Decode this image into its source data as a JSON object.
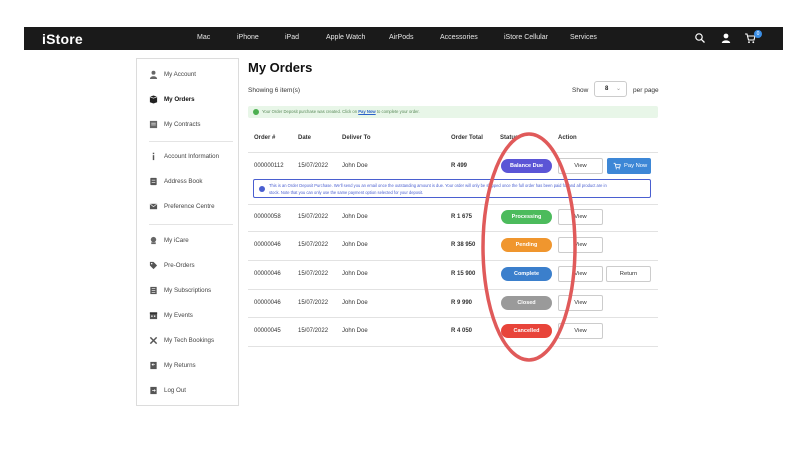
{
  "nav": {
    "brand": "iStore",
    "items": [
      "Mac",
      "iPhone",
      "iPad",
      "Apple Watch",
      "AirPods",
      "Accessories",
      "iStore Cellular",
      "Services"
    ],
    "cart_count": "0"
  },
  "sidebar": {
    "items": [
      {
        "label": "My Account",
        "icon": "user-icon"
      },
      {
        "label": "My Orders",
        "icon": "orders-icon"
      },
      {
        "label": "My Contracts",
        "icon": "contract-icon"
      },
      {
        "label": "Account Information",
        "icon": "info-icon"
      },
      {
        "label": "Address Book",
        "icon": "address-book-icon"
      },
      {
        "label": "Preference Centre",
        "icon": "mail-icon"
      },
      {
        "label": "My iCare",
        "icon": "care-icon"
      },
      {
        "label": "Pre-Orders",
        "icon": "tag-icon"
      },
      {
        "label": "My Subscriptions",
        "icon": "subscriptions-icon"
      },
      {
        "label": "My Events",
        "icon": "calendar-icon"
      },
      {
        "label": "My Tech Bookings",
        "icon": "tools-icon"
      },
      {
        "label": "My Returns",
        "icon": "return-icon"
      },
      {
        "label": "Log Out",
        "icon": "logout-icon"
      }
    ]
  },
  "main": {
    "title": "My Orders",
    "showing": "Showing 6 item(s)",
    "show_label": "Show",
    "per_page_value": "8",
    "per_page_label": "per page",
    "notice_prefix": "Your Order Deposit purchase was created. Click on",
    "notice_link": "Pay Now",
    "notice_suffix": "to complete your order.",
    "columns": [
      "Order #",
      "Date",
      "Deliver To",
      "Order Total",
      "Status",
      "Action"
    ],
    "deposit_note_line1": "This is an Order Deposit Purchase. We'll send you an email once the outstanding amount is due. Your order will only be shipped once the full order has been paid for and all product are in",
    "deposit_note_line2": "stock. Note that you can only use the same payment option selected for your deposit.",
    "orders": [
      {
        "id": "000000112",
        "date": "15/07/2022",
        "deliver_to": "John Doe",
        "total": "R 499",
        "status": "Balance Due",
        "status_color": "#5b55d6",
        "view": "View",
        "extra": "Pay Now"
      },
      {
        "id": "00000058",
        "date": "15/07/2022",
        "deliver_to": "John Doe",
        "total": "R 1 675",
        "status": "Processing",
        "status_color": "#4cbb5c",
        "view": "View",
        "extra": ""
      },
      {
        "id": "00000046",
        "date": "15/07/2022",
        "deliver_to": "John Doe",
        "total": "R 38 950",
        "status": "Pending",
        "status_color": "#f0962e",
        "view": "View",
        "extra": ""
      },
      {
        "id": "00000046",
        "date": "15/07/2022",
        "deliver_to": "John Doe",
        "total": "R 15 900",
        "status": "Complete",
        "status_color": "#3b7fcc",
        "view": "View",
        "extra": "Return"
      },
      {
        "id": "00000046",
        "date": "15/07/2022",
        "deliver_to": "John Doe",
        "total": "R 9 990",
        "status": "Closed",
        "status_color": "#9a9a9a",
        "view": "View",
        "extra": ""
      },
      {
        "id": "00000045",
        "date": "15/07/2022",
        "deliver_to": "John Doe",
        "total": "R 4 050",
        "status": "Cancelled",
        "status_color": "#e8443a",
        "view": "View",
        "extra": ""
      }
    ]
  },
  "annotation_color": "#e05a5a"
}
